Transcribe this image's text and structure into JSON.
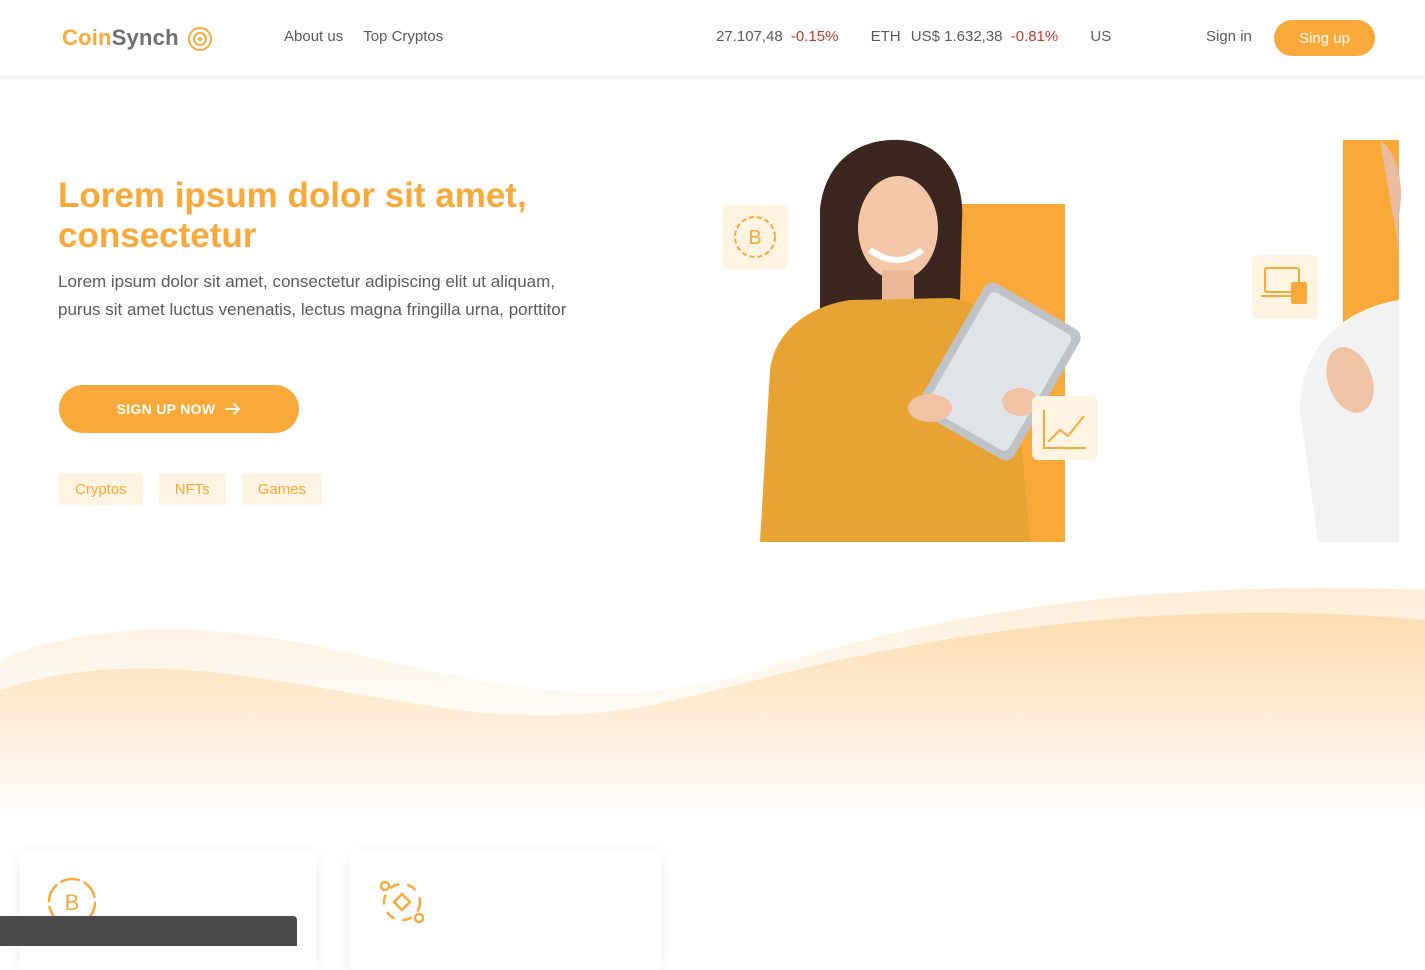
{
  "brand": {
    "part1": "Coin",
    "part2": "Synch"
  },
  "colors": {
    "accent": "#f9a93a",
    "accent_light": "#fff3e2",
    "negative": "#c0392b",
    "text": "#5b5b5b"
  },
  "nav": {
    "items": [
      "About us",
      "Top Cryptos"
    ]
  },
  "ticker": [
    {
      "symbol": "",
      "price": "27.107,48",
      "change": "-0.15%"
    },
    {
      "symbol": "ETH",
      "price": "US$ 1.632,38",
      "change": "-0.81%"
    },
    {
      "symbol": "",
      "price": "US",
      "change": ""
    }
  ],
  "auth": {
    "signin_label": "Sign in",
    "signup_label": "Sing up"
  },
  "hero": {
    "title": "Lorem ipsum dolor sit amet, consectetur",
    "text": "Lorem ipsum dolor sit amet, consectetur adipiscing elit ut aliquam, purus sit amet luctus venenatis, lectus magna fringilla urna, porttitor",
    "cta_label": "SIGN UP NOW",
    "tags": [
      "Cryptos",
      "NFTs",
      "Games"
    ]
  },
  "icons": {
    "logo": "coin-logo-icon",
    "cta_arrow": "arrow-right-icon",
    "hero_badges": [
      "bitcoin-icon",
      "chart-line-icon",
      "laptop-phone-icon"
    ],
    "cards": [
      "bitcoin-icon",
      "crypto-network-icon"
    ]
  }
}
